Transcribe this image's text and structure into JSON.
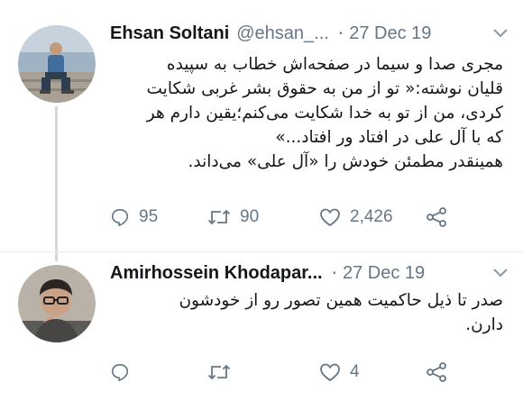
{
  "tweets": [
    {
      "display_name": "Ehsan Soltani",
      "handle": "@ehsan_...",
      "separator": "·",
      "date": "27 Dec 19",
      "text_lines": [
        "مجری صدا و سیما در صفحه‌اش خطاب به سپیده",
        "قلیان نوشته:« تو از من به حقوق بشر غربی شکایت",
        "کردی، من از تو به خدا شکایت می‌کنم؛یقین دارم هر",
        "که با آل علی در افتاد ور افتاد...»",
        "همینقدر مطمئن خودش را «آل علی» می‌داند."
      ],
      "replies": "95",
      "retweets": "90",
      "likes": "2,426"
    },
    {
      "display_name": "Amirhossein Khodapar...",
      "separator": "·",
      "date": "27 Dec 19",
      "text_lines": [
        "صدر تا ذیل حاکمیت همین تصور رو از خودشون",
        "دارن."
      ],
      "likes": "4"
    }
  ],
  "icons": {
    "reply": "reply-icon",
    "retweet": "retweet-icon",
    "like": "heart-icon",
    "share": "share-icon",
    "menu": "chevron-down-icon"
  },
  "colors": {
    "text": "#14171a",
    "secondary": "#657786",
    "thread_line": "#cfd9de"
  }
}
